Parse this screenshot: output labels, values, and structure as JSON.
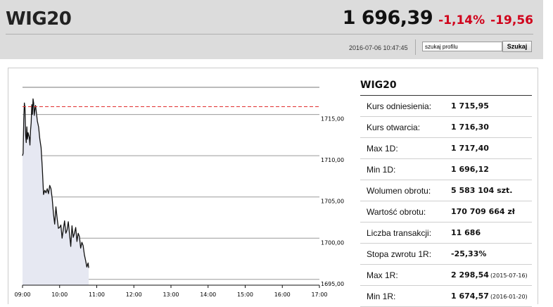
{
  "header": {
    "ticker": "WIG20",
    "price": "1 696,39",
    "change_pct": "-1,14%",
    "change_abs": "-19,56",
    "timestamp": "2016-07-06 10:47:45",
    "search_value": "szukaj profilu",
    "search_button": "Szukaj"
  },
  "table": {
    "title": "WIG20",
    "rows": [
      {
        "label": "Kurs odniesienia:",
        "value": "1 715,95",
        "note": ""
      },
      {
        "label": "Kurs otwarcia:",
        "value": "1 716,30",
        "note": ""
      },
      {
        "label": "Max 1D:",
        "value": "1 717,40",
        "note": ""
      },
      {
        "label": "Min 1D:",
        "value": "1 696,12",
        "note": ""
      },
      {
        "label": "Wolumen obrotu:",
        "value": "5 583 104 szt.",
        "note": ""
      },
      {
        "label": "Wartość obrotu:",
        "value": "170 709 664 zł",
        "note": ""
      },
      {
        "label": "Liczba transakcji:",
        "value": "11 686",
        "note": ""
      },
      {
        "label": "Stopa zwrotu 1R:",
        "value": "-25,33%",
        "note": ""
      },
      {
        "label": "Max 1R:",
        "value": "2 298,54",
        "note": "(2015-07-16)"
      },
      {
        "label": "Min 1R:",
        "value": "1 674,57",
        "note": "(2016-01-20)"
      }
    ]
  },
  "chart_data": {
    "type": "area",
    "title": "",
    "xlabel": "",
    "ylabel": "",
    "ylim": [
      1694.3,
      1718.3
    ],
    "xlim": [
      "09:00",
      "17:00"
    ],
    "x_ticks": [
      "09:00",
      "10:00",
      "11:00",
      "12:00",
      "13:00",
      "14:00",
      "15:00",
      "16:00",
      "17:00"
    ],
    "y_ticks": [
      1695,
      1700,
      1705,
      1710,
      1715
    ],
    "y_tick_labels": [
      "1695,00",
      "1700,00",
      "1705,00",
      "1710,00",
      "1715,00"
    ],
    "reference_line": 1715.95,
    "grid": "horizontal",
    "colors": {
      "line": "#111111",
      "fill": "#e6e8f2",
      "reference": "#e0302f",
      "grid": "#9a9a9a"
    },
    "series": [
      {
        "x": [
          "09:00",
          "09:01",
          "09:02",
          "09:03",
          "09:04",
          "09:05",
          "09:06",
          "09:07",
          "09:08",
          "09:09",
          "09:10",
          "09:11",
          "09:12",
          "09:13",
          "09:14",
          "09:15",
          "09:16",
          "09:17",
          "09:18",
          "09:19",
          "09:20",
          "09:21",
          "09:22",
          "09:24",
          "09:26",
          "09:28",
          "09:30",
          "09:32",
          "09:34",
          "09:36",
          "09:38",
          "09:40",
          "09:42",
          "09:44",
          "09:46",
          "09:48",
          "09:50",
          "09:52",
          "09:54",
          "09:56",
          "09:58",
          "10:00",
          "10:02",
          "10:04",
          "10:06",
          "10:08",
          "10:10",
          "10:12",
          "10:14",
          "10:16",
          "10:18",
          "10:20",
          "10:22",
          "10:24",
          "10:26",
          "10:28",
          "10:30",
          "10:32",
          "10:34",
          "10:36",
          "10:38",
          "10:40",
          "10:42",
          "10:44",
          "10:46",
          "10:47"
        ],
        "values": [
          1710.0,
          1710.3,
          1714.4,
          1716.4,
          1715.8,
          1712.5,
          1711.6,
          1713.5,
          1712.0,
          1712.8,
          1712.5,
          1712.2,
          1711.3,
          1713.1,
          1714.0,
          1716.2,
          1715.0,
          1716.9,
          1716.4,
          1714.9,
          1715.6,
          1716.1,
          1715.5,
          1714.2,
          1713.5,
          1712.0,
          1711.0,
          1708.5,
          1705.3,
          1705.8,
          1705.5,
          1706.0,
          1705.4,
          1706.4,
          1706.0,
          1704.8,
          1703.0,
          1701.7,
          1703.8,
          1702.4,
          1701.2,
          1701.3,
          1701.6,
          1700.0,
          1701.1,
          1702.1,
          1700.6,
          1701.0,
          1702.0,
          1700.5,
          1699.0,
          1701.5,
          1700.1,
          1700.6,
          1701.3,
          1699.6,
          1700.6,
          1700.2,
          1698.8,
          1699.5,
          1699.1,
          1698.0,
          1697.3,
          1696.5,
          1697.0,
          1696.4
        ]
      }
    ]
  }
}
